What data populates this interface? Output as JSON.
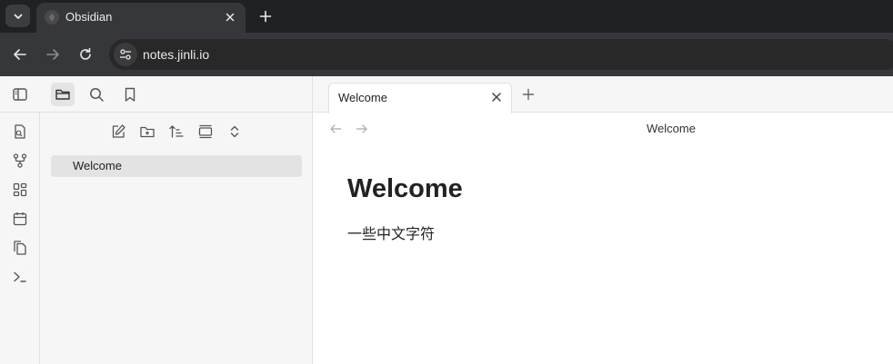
{
  "browser": {
    "tab_title": "Obsidian",
    "url": "notes.jinli.io"
  },
  "obsidian": {
    "file_explorer": {
      "files": [
        "Welcome"
      ]
    },
    "editor": {
      "tab_title": "Welcome",
      "view_title": "Welcome",
      "heading": "Welcome",
      "paragraph": "一些中文字符"
    }
  },
  "colors": {
    "browser_dark": "#202124",
    "browser_toolbar": "#36373a",
    "sidebar_bg": "#f6f6f6",
    "active_item": "#e3e3e3"
  }
}
